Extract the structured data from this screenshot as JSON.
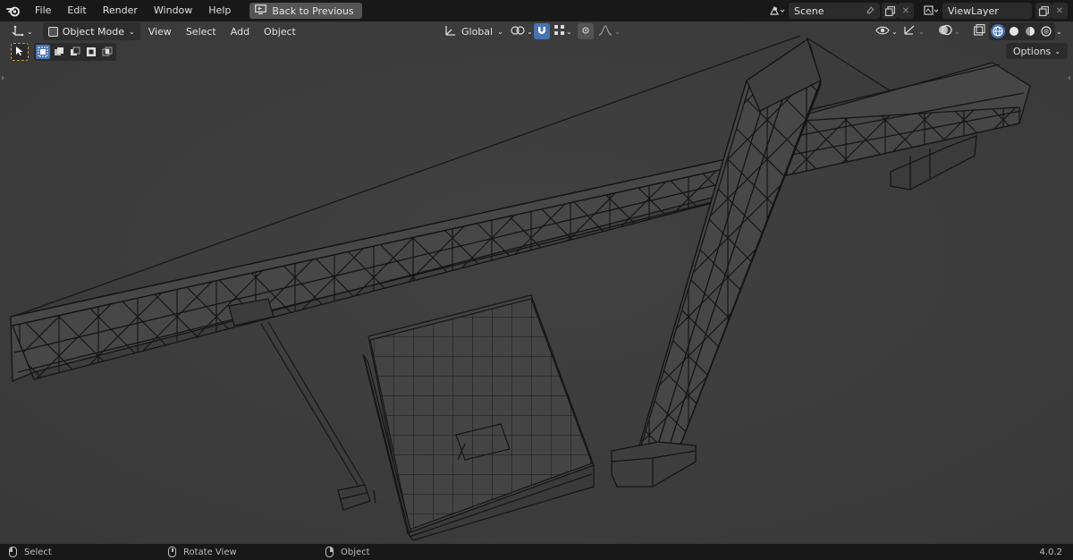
{
  "topbar": {
    "menu": [
      "File",
      "Edit",
      "Render",
      "Window",
      "Help"
    ],
    "back_button": "Back to Previous",
    "scene_name": "Scene",
    "view_layer": "ViewLayer"
  },
  "viewport_header": {
    "mode": "Object Mode",
    "menus": [
      "View",
      "Select",
      "Add",
      "Object"
    ],
    "transform_orientation": "Global",
    "options": "Options"
  },
  "statusbar": {
    "left": "Select",
    "middle": "Rotate View",
    "right": "Object",
    "version": "4.0.2"
  },
  "colors": {
    "accent": "#4772b3",
    "viewport_bg": "#3d3d3d",
    "wire": "#121212"
  },
  "icons": {
    "logo": "blender-logo-icon",
    "back": "screen-back-icon",
    "scene": "scene-icon",
    "view_layer": "view-layer-icon"
  }
}
